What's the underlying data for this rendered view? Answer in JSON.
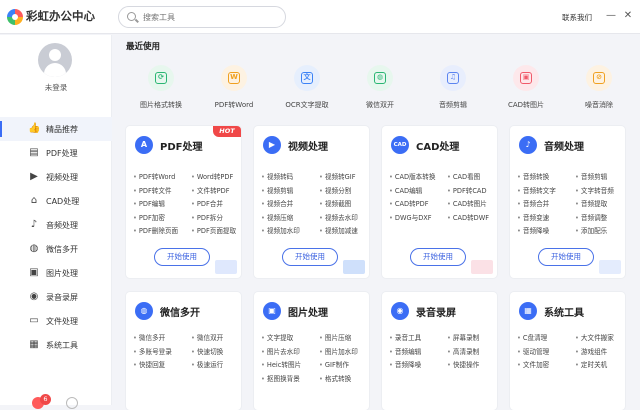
{
  "app": {
    "title": "彩虹办公中心"
  },
  "search": {
    "placeholder": "搜索工具"
  },
  "header": {
    "contact": "联系我们",
    "minimize": "—",
    "close": "✕"
  },
  "user": {
    "login": "未登录"
  },
  "sidebar": {
    "items": [
      {
        "label": "精品推荐",
        "icon": "thumbs-up-icon",
        "glyph": "👍",
        "active": true
      },
      {
        "label": "PDF处理",
        "icon": "pdf-icon",
        "glyph": "▤"
      },
      {
        "label": "视频处理",
        "icon": "video-icon",
        "glyph": "▶"
      },
      {
        "label": "CAD处理",
        "icon": "cad-icon",
        "glyph": "⌂"
      },
      {
        "label": "音频处理",
        "icon": "audio-icon",
        "glyph": "♪"
      },
      {
        "label": "微信多开",
        "icon": "wechat-icon",
        "glyph": "◍"
      },
      {
        "label": "图片处理",
        "icon": "image-icon",
        "glyph": "▣"
      },
      {
        "label": "录音录屏",
        "icon": "record-icon",
        "glyph": "◉"
      },
      {
        "label": "文件处理",
        "icon": "folder-icon",
        "glyph": "▭"
      },
      {
        "label": "系统工具",
        "icon": "system-icon",
        "glyph": "▦"
      }
    ],
    "notification_count": "6"
  },
  "recent": {
    "title": "最近使用",
    "items": [
      {
        "label": "图片格式转换",
        "icon": "image-convert-icon",
        "glyph": "⟳",
        "color": "#2ab673",
        "bg": "#e7f7ee"
      },
      {
        "label": "PDF转Word",
        "icon": "pdf-to-word-icon",
        "glyph": "W",
        "color": "#f0a020",
        "bg": "#fdf2e2"
      },
      {
        "label": "OCR文字提取",
        "icon": "ocr-icon",
        "glyph": "文",
        "color": "#3b82f6",
        "bg": "#e6effd"
      },
      {
        "label": "微信双开",
        "icon": "wechat-dual-icon",
        "glyph": "◍",
        "color": "#2ab673",
        "bg": "#e7f7ee"
      },
      {
        "label": "音频剪辑",
        "icon": "audio-edit-icon",
        "glyph": "♫",
        "color": "#5b84f0",
        "bg": "#e8eefd"
      },
      {
        "label": "CAD转图片",
        "icon": "cad-to-image-icon",
        "glyph": "▣",
        "color": "#f05a6a",
        "bg": "#fde8eb"
      },
      {
        "label": "噪音消除",
        "icon": "noise-remove-icon",
        "glyph": "⊘",
        "color": "#f0a020",
        "bg": "#fdf2e2"
      }
    ]
  },
  "cards": [
    {
      "title": "PDF处理",
      "icon": "pdf-icon",
      "glyph": "A",
      "color": "#3b6df5",
      "hot": "HOT",
      "features": [
        "PDF转Word",
        "Word转PDF",
        "PDF转文件",
        "文件转PDF",
        "PDF编辑",
        "PDF合并",
        "PDF加密",
        "PDF拆分",
        "PDF删除页面",
        "PDF页面提取"
      ],
      "button": "开始使用"
    },
    {
      "title": "视频处理",
      "icon": "video-icon",
      "glyph": "▶",
      "color": "#3b6df5",
      "features": [
        "视频转码",
        "视频转GIF",
        "视频剪辑",
        "视频分割",
        "视频合并",
        "视频截图",
        "视频压缩",
        "视频去水印",
        "视频加水印",
        "视频加减速"
      ],
      "button": "开始使用"
    },
    {
      "title": "CAD处理",
      "icon": "cad-icon",
      "glyph": "CAD",
      "color": "#3b6df5",
      "features": [
        "CAD版本转换",
        "CAD看图",
        "CAD编辑",
        "PDF转CAD",
        "CAD转PDF",
        "CAD转图片",
        "DWG与DXF",
        "CAD转DWF"
      ],
      "button": "开始使用"
    },
    {
      "title": "音频处理",
      "icon": "audio-icon",
      "glyph": "♪",
      "color": "#3b6df5",
      "features": [
        "音频转换",
        "音频剪辑",
        "音频转文字",
        "文字转音频",
        "音频合并",
        "音频提取",
        "音频变速",
        "音频调整",
        "音频降噪",
        "添加配乐"
      ],
      "button": "开始使用"
    },
    {
      "title": "微信多开",
      "icon": "wechat-icon",
      "glyph": "◍",
      "color": "#3b6df5",
      "features": [
        "微信多开",
        "微信双开",
        "多账号登录",
        "快速切换",
        "快捷回复",
        "极速运行"
      ]
    },
    {
      "title": "图片处理",
      "icon": "image-icon",
      "glyph": "▣",
      "color": "#3b6df5",
      "features": [
        "文字提取",
        "图片压缩",
        "图片去水印",
        "图片加水印",
        "Heic转图片",
        "GIF制作",
        "抠图换背景",
        "格式转换"
      ]
    },
    {
      "title": "录音录屏",
      "icon": "record-icon",
      "glyph": "◉",
      "color": "#3b6df5",
      "features": [
        "录音工具",
        "屏幕录制",
        "音频编辑",
        "高清录制",
        "音频降噪",
        "快捷操作"
      ]
    },
    {
      "title": "系统工具",
      "icon": "system-icon",
      "glyph": "▦",
      "color": "#3b6df5",
      "features": [
        "C盘清理",
        "大文件搬家",
        "驱动管理",
        "游戏组件",
        "文件加密",
        "定时关机"
      ]
    }
  ]
}
